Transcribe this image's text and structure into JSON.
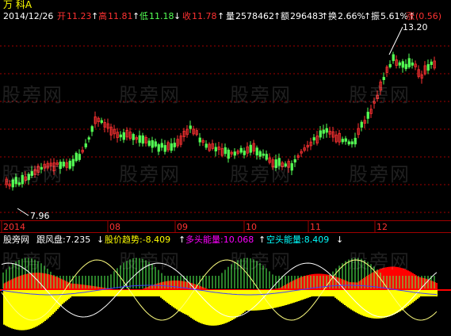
{
  "header": {
    "row1": {
      "name": "万  科A",
      "date": "2014/12/26",
      "open_label": "开",
      "open_value": "11.23",
      "high_label": "高",
      "high_value": "11.81",
      "low_label": "低",
      "low_value": "11.18",
      "close_label": "收",
      "close_value": "11.78",
      "volume_label": "量",
      "volume_value": "2578462",
      "amount_label": "额",
      "amount_value": "296483",
      "turnover_label": "换",
      "turnover_value": "2.66%",
      "amplitude_label": "振",
      "amplitude_value": "5.61%",
      "change_label": "涨",
      "change_value": "(0.56)"
    }
  },
  "price_panel": {
    "high_marker": "13.20",
    "low_marker": "7.96"
  },
  "date_axis": {
    "labels": [
      "2014",
      "08",
      "09",
      "10",
      "11",
      "12"
    ]
  },
  "indicator": {
    "name": "股旁网",
    "main_label": "跟风盘:7.235",
    "trend_label": "股价趋势:-8.409",
    "long_label": "多头能量:10.068",
    "short_label": "空头能量:8.409"
  },
  "watermark": {
    "text": "股旁网"
  },
  "colors": {
    "background": "#000000",
    "up": "#ff3232",
    "down": "#54ff54",
    "text_white": "#ffffff",
    "text_yellow": "#ffff00",
    "text_cyan": "#00ffff",
    "text_magenta": "#ff00ff",
    "grid_red": "#a00000",
    "long_energy": "#ff0000",
    "short_energy": "#ffff00"
  }
}
